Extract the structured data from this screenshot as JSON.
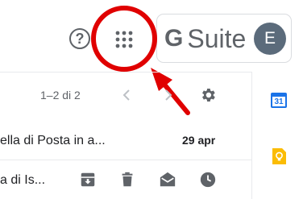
{
  "header": {
    "help_icon": "help-circle-icon",
    "help_glyph": "?",
    "apps_icon": "apps-grid-icon",
    "brand": {
      "g_letter": "G",
      "suite_text": "Suite"
    },
    "avatar_initial": "E"
  },
  "toolbar": {
    "page_count": "1–2 di 2",
    "prev_icon": "chevron-left-icon",
    "next_icon": "chevron-right-icon",
    "settings_icon": "gear-icon"
  },
  "mail_rows": [
    {
      "subject": "ella di Posta in a...",
      "date": "29 apr"
    },
    {
      "subject": "a di Is...",
      "actions": [
        "archive-icon",
        "delete-icon",
        "mark-read-icon",
        "snooze-icon"
      ]
    }
  ],
  "side_panel": {
    "calendar_day": "31",
    "keep_icon": "lightbulb-icon"
  },
  "colors": {
    "annotation_red": "#e00000",
    "icon_gray": "#5f6368",
    "avatar_bg": "#5b6b7b",
    "calendar_blue": "#1a73e8",
    "keep_yellow": "#fbbc04"
  }
}
